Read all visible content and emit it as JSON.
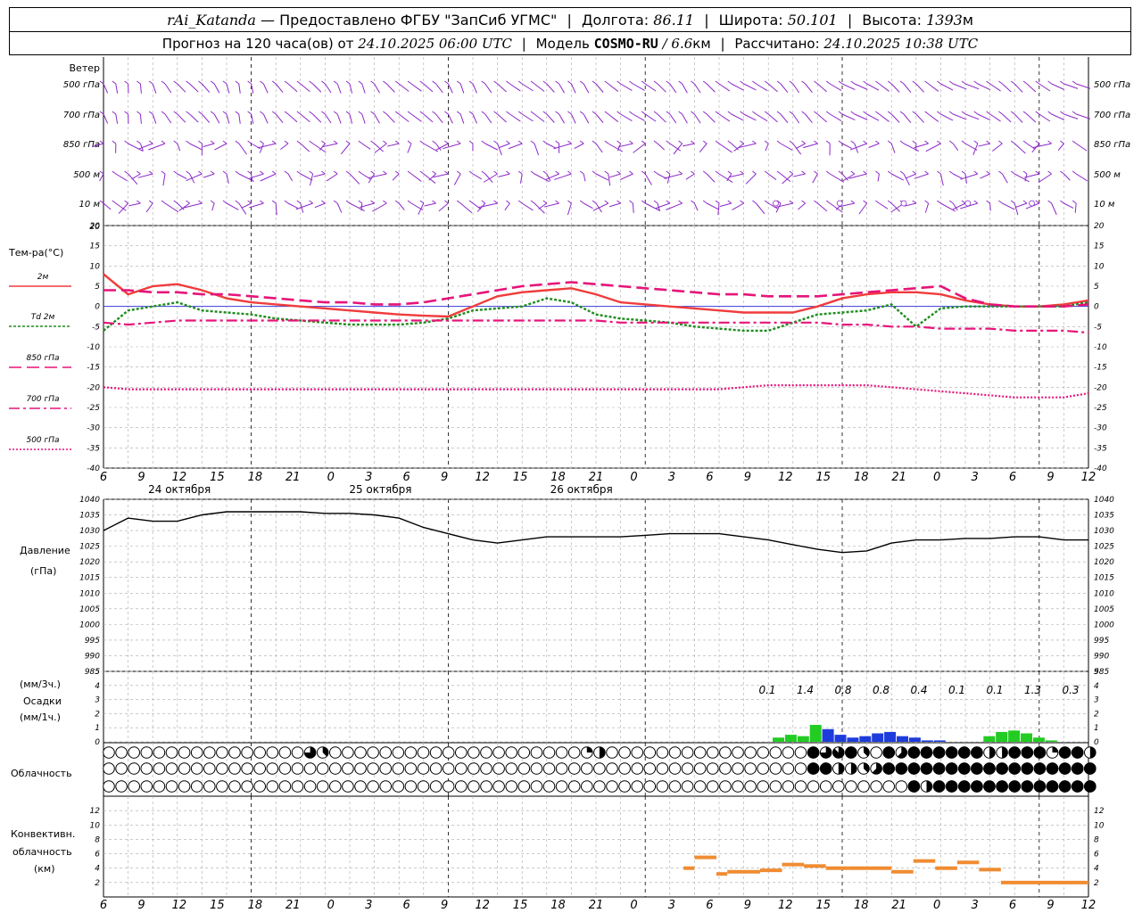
{
  "header": {
    "station": "rAi_Katanda",
    "dash": "—",
    "provider": "Предоставлено ФГБУ \"ЗапСиб УГМС\"",
    "lon_label": "Долгота:",
    "lon": "86.11",
    "lat_label": "Широта:",
    "lat": "50.101",
    "alt_label": "Высота:",
    "alt": "1393",
    "alt_unit": "м",
    "forecast_label": "Прогноз на 120 часа(ов) от",
    "forecast_time": "24.10.2025 06:00 UTC",
    "model_label": "Модель",
    "model": "COSMO-RU",
    "model_res": "/ 6.6",
    "model_res_unit": "км",
    "calc_label": "Рассчитано:",
    "calc_time": "24.10.2025 10:38 UTC"
  },
  "chart_data": [
    {
      "type": "wind-barbs",
      "title": "Ветер",
      "levels": [
        "500 гПа",
        "700 гПа",
        "850 гПа",
        "500 м",
        "10 м"
      ],
      "hours": [
        6,
        9,
        12,
        15,
        18,
        21,
        0,
        3,
        6,
        9,
        12,
        15,
        18,
        21,
        0,
        3,
        6,
        9,
        12,
        15,
        18,
        21,
        0,
        3,
        6,
        9,
        12
      ],
      "calm_markers_10m": [
        10.5,
        11.5,
        12.5,
        13.5,
        14.5
      ]
    },
    {
      "type": "line",
      "ylabel": "Тем-ра(°C)",
      "ylim": [
        -40,
        20
      ],
      "yticks": [
        20,
        15,
        10,
        5,
        0,
        -5,
        -10,
        -15,
        -20,
        -25,
        -30,
        -35,
        -40
      ],
      "x_hours_since_start": [
        0,
        1,
        2,
        3,
        4,
        5,
        6,
        7,
        8,
        9,
        10,
        11,
        12,
        13,
        14,
        15,
        16,
        17,
        18,
        19,
        20,
        21,
        22,
        23,
        24,
        25,
        26,
        27,
        28,
        29,
        30,
        31,
        32,
        33,
        34,
        35,
        36,
        37,
        38,
        39,
        40
      ],
      "series": [
        {
          "name": "2м",
          "color": "#f03c3c",
          "style": "solid",
          "values": [
            8,
            3,
            5,
            5.5,
            4,
            2,
            1,
            0.5,
            0,
            -0.5,
            -1,
            -1.5,
            -2,
            -2.3,
            -2.5,
            0,
            2.5,
            3.5,
            4,
            4.5,
            3,
            1,
            0.5,
            0,
            -0.5,
            -1,
            -1.5,
            -1.5,
            -1.5,
            0,
            2,
            3,
            3.5,
            3.5,
            3,
            1.5,
            0.5,
            0,
            0,
            0.5,
            1.5
          ]
        },
        {
          "name": "Td 2м",
          "color": "#1e8c1e",
          "style": "dotted",
          "values": [
            -6,
            -1,
            0,
            1,
            -1,
            -1.5,
            -2,
            -3,
            -3.5,
            -4,
            -4.5,
            -4.5,
            -4.5,
            -4,
            -3,
            -1,
            -0.5,
            0,
            2,
            1,
            -2,
            -3,
            -3.5,
            -4,
            -5,
            -5.5,
            -6,
            -6,
            -4,
            -2,
            -1.5,
            -1,
            0.5,
            -5,
            -0.5,
            0,
            0,
            0,
            0,
            0,
            1
          ]
        },
        {
          "name": "850 гПа",
          "color": "#e6147a",
          "style": "dashed",
          "values": [
            4,
            4,
            3.5,
            3.5,
            3,
            3,
            2.5,
            2,
            1.5,
            1,
            1,
            0.5,
            0.5,
            1,
            2,
            3,
            4,
            5,
            5.5,
            6,
            5.5,
            5,
            4.5,
            4,
            3.5,
            3,
            3,
            2.5,
            2.5,
            2.5,
            3,
            3.5,
            4,
            4.5,
            5,
            2,
            0.5,
            0,
            0,
            0,
            0.5
          ]
        },
        {
          "name": "700 гПа",
          "color": "#e6147a",
          "style": "dashdot",
          "values": [
            -4,
            -4.5,
            -4,
            -3.5,
            -3.5,
            -3.5,
            -3.5,
            -3.5,
            -3.5,
            -3.5,
            -3.5,
            -3.5,
            -3.5,
            -3.5,
            -3.5,
            -3.5,
            -3.5,
            -3.5,
            -3.5,
            -3.5,
            -3.5,
            -4,
            -4,
            -4,
            -4,
            -4,
            -4,
            -4,
            -4,
            -4,
            -4.5,
            -4.5,
            -5,
            -5,
            -5.5,
            -5.5,
            -5.5,
            -6,
            -6,
            -6,
            -6.5
          ]
        },
        {
          "name": "500 гПа",
          "color": "#e6147a",
          "style": "dotted-dense",
          "values": [
            -20,
            -20.5,
            -20.5,
            -20.5,
            -20.5,
            -20.5,
            -20.5,
            -20.5,
            -20.5,
            -20.5,
            -20.5,
            -20.5,
            -20.5,
            -20.5,
            -20.5,
            -20.5,
            -20.5,
            -20.5,
            -20.5,
            -20.5,
            -20.5,
            -20.5,
            -20.5,
            -20.5,
            -20.5,
            -20.5,
            -20,
            -19.5,
            -19.5,
            -19.5,
            -19.5,
            -19.5,
            -20,
            -20.5,
            -21,
            -21.5,
            -22,
            -22.5,
            -22.5,
            -22.5,
            -21.5
          ]
        }
      ]
    },
    {
      "type": "line",
      "ylabel": "Давление",
      "ylabel2": "(гПа)",
      "ylim": [
        985,
        1040
      ],
      "yticks": [
        1040,
        1035,
        1030,
        1025,
        1020,
        1015,
        1010,
        1005,
        1000,
        995,
        990,
        985
      ],
      "series": [
        {
          "name": "Давление",
          "color": "#000000",
          "values": [
            1030,
            1034,
            1033,
            1033,
            1035,
            1036,
            1036,
            1036,
            1036,
            1035.5,
            1035.5,
            1035,
            1034,
            1031,
            1029,
            1027,
            1026,
            1027,
            1028,
            1028,
            1028,
            1028,
            1028.5,
            1029,
            1029,
            1029,
            1028,
            1027,
            1025.5,
            1024,
            1023,
            1023.5,
            1026,
            1027,
            1027,
            1027.5,
            1027.5,
            1028,
            1028,
            1027,
            1027
          ]
        }
      ]
    },
    {
      "type": "bar",
      "ylabel": "(мм/3ч.)",
      "ylabel2": "Осадки",
      "ylabel3": "(мм/1ч.)",
      "ylim": [
        0,
        5
      ],
      "yticks": [
        5,
        4,
        3,
        2,
        1,
        0
      ],
      "totals_3h": [
        "0.1",
        "1.4",
        "0.8",
        "0.8",
        "0.4",
        "0.1",
        "0.1",
        "1.3",
        "0.3"
      ],
      "series": [
        {
          "name": "rain",
          "color": "#22cc22",
          "values": [
            0,
            0,
            0,
            0,
            0,
            0,
            0,
            0,
            0,
            0,
            0,
            0,
            0,
            0,
            0,
            0,
            0,
            0,
            0,
            0,
            0,
            0,
            0,
            0,
            0,
            0,
            0,
            0,
            0,
            0,
            0,
            0,
            0,
            0,
            0.3,
            0.5,
            0.4,
            1.2,
            0.6,
            0.2,
            0.1,
            0,
            0,
            0.05,
            0,
            0,
            0,
            0,
            0,
            0,
            0,
            0.4,
            0.7,
            0.8,
            0.6,
            0.3,
            0.1
          ]
        },
        {
          "name": "snow",
          "color": "#1e3cdc",
          "values": [
            0,
            0,
            0,
            0,
            0,
            0,
            0,
            0,
            0,
            0,
            0,
            0,
            0,
            0,
            0,
            0,
            0,
            0,
            0,
            0,
            0,
            0,
            0,
            0,
            0,
            0,
            0,
            0,
            0,
            0,
            0,
            0,
            0,
            0,
            0,
            0,
            0,
            0,
            0.9,
            0.5,
            0.3,
            0.4,
            0.6,
            0.7,
            0.4,
            0.3,
            0.1,
            0.1,
            0,
            0,
            0,
            0,
            0,
            0,
            0,
            0,
            0
          ]
        }
      ]
    },
    {
      "type": "table",
      "ylabel": "Облачность",
      "rows": [
        "upper",
        "middle",
        "lower"
      ],
      "cover_eighths": {
        "upper": [
          0,
          0,
          0,
          0,
          0,
          0,
          0,
          0,
          0,
          0,
          0,
          0,
          0,
          0,
          0,
          0,
          6,
          3,
          0,
          0,
          0,
          0,
          0,
          0,
          0,
          0,
          0,
          0,
          0,
          0,
          0,
          0,
          0,
          0,
          0,
          0,
          0,
          0,
          2,
          4,
          0,
          0,
          0,
          0,
          0,
          0,
          0,
          0,
          0,
          0,
          0,
          0,
          0,
          0,
          0,
          0,
          8,
          6,
          7,
          8,
          3,
          0,
          8,
          5,
          8,
          8,
          8,
          8,
          8,
          8,
          4,
          4,
          8,
          8,
          8,
          2,
          8,
          8,
          4,
          6,
          2,
          8,
          8,
          8,
          8,
          8,
          8
        ],
        "middle": [
          0,
          0,
          0,
          0,
          0,
          0,
          0,
          0,
          0,
          0,
          0,
          0,
          0,
          0,
          0,
          0,
          0,
          0,
          0,
          0,
          0,
          0,
          0,
          0,
          0,
          0,
          0,
          0,
          0,
          0,
          0,
          0,
          0,
          0,
          0,
          0,
          0,
          0,
          0,
          0,
          0,
          0,
          0,
          0,
          0,
          0,
          0,
          0,
          0,
          0,
          0,
          0,
          0,
          0,
          0,
          0,
          8,
          8,
          4,
          4,
          3,
          5,
          8,
          8,
          8,
          8,
          8,
          8,
          8,
          8,
          8,
          8,
          8,
          8,
          8,
          8,
          8,
          8,
          8,
          8,
          8,
          8,
          8,
          8,
          8,
          8,
          4
        ],
        "lower": [
          0,
          0,
          0,
          0,
          0,
          0,
          0,
          0,
          0,
          0,
          0,
          0,
          0,
          0,
          0,
          0,
          0,
          0,
          0,
          0,
          0,
          0,
          0,
          0,
          0,
          0,
          0,
          0,
          0,
          0,
          0,
          0,
          0,
          0,
          0,
          0,
          0,
          0,
          0,
          0,
          0,
          0,
          0,
          0,
          0,
          0,
          0,
          0,
          0,
          0,
          0,
          0,
          0,
          0,
          0,
          0,
          0,
          0,
          0,
          0,
          0,
          0,
          0,
          0,
          8,
          4,
          8,
          8,
          8,
          8,
          8,
          8,
          8,
          8,
          8,
          8,
          8,
          8,
          8,
          4,
          6,
          8,
          8,
          8,
          8,
          8,
          8
        ]
      }
    },
    {
      "type": "bar",
      "ylabel": "Конвективн.",
      "ylabel2": "облачность",
      "ylabel3": "(км)",
      "ylim": [
        0,
        14
      ],
      "yticks": [
        12,
        10,
        8,
        6,
        4,
        2
      ],
      "series": [
        {
          "name": "convective",
          "color": "#f08c32",
          "segments": [
            [
              26.5,
              27,
              4
            ],
            [
              27,
              28,
              5.5
            ],
            [
              28,
              28.5,
              3.2
            ],
            [
              28.5,
              30,
              3.5
            ],
            [
              30,
              31,
              3.7
            ],
            [
              31,
              32,
              4.5
            ],
            [
              32,
              33,
              4.3
            ],
            [
              33,
              34,
              4
            ],
            [
              34,
              36,
              4
            ],
            [
              36,
              37,
              3.5
            ],
            [
              37,
              38,
              5
            ],
            [
              38,
              39,
              4
            ],
            [
              39,
              40,
              4.8
            ],
            [
              40,
              41,
              3.8
            ],
            [
              41,
              45,
              2
            ]
          ]
        }
      ]
    }
  ],
  "axis": {
    "hour_labels": [
      "6",
      "9",
      "12",
      "15",
      "18",
      "21",
      "0",
      "3",
      "6",
      "9",
      "12",
      "15",
      "18",
      "21",
      "0",
      "3",
      "6",
      "9",
      "12",
      "15",
      "18",
      "21",
      "0",
      "3",
      "6",
      "9",
      "12"
    ],
    "day_labels": [
      "24 октября",
      "25 октября",
      "26 октября"
    ]
  },
  "colors": {
    "wind": "#8c28c8",
    "t2m": "#f03c3c",
    "td": "#1e8c1e",
    "upper_air": "#e6147a",
    "rain": "#22cc22",
    "snow": "#1e3cdc",
    "convective": "#f08c32",
    "zero_line": "#3c3cdc"
  }
}
